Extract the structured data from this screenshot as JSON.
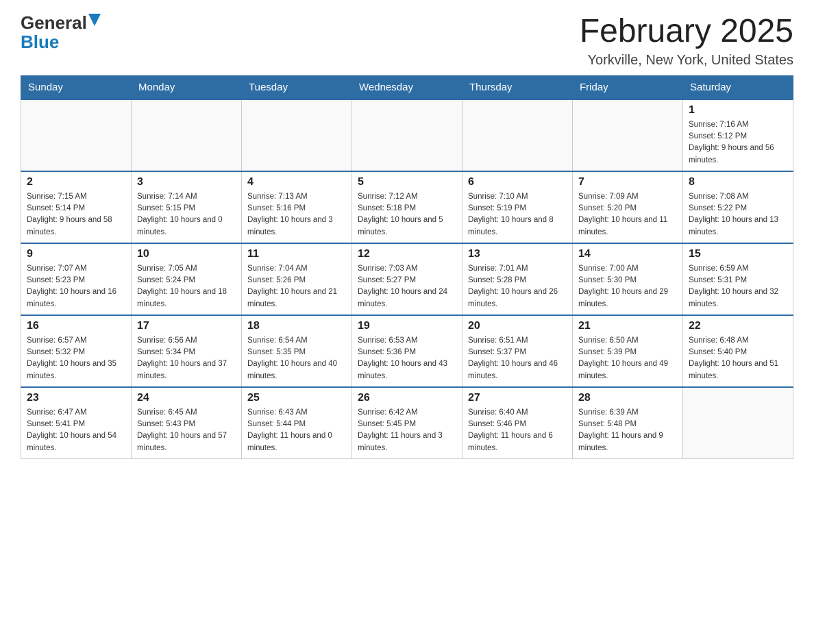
{
  "header": {
    "logo_general": "General",
    "logo_blue": "Blue",
    "month_year": "February 2025",
    "location": "Yorkville, New York, United States"
  },
  "weekdays": [
    "Sunday",
    "Monday",
    "Tuesday",
    "Wednesday",
    "Thursday",
    "Friday",
    "Saturday"
  ],
  "weeks": [
    [
      {
        "day": "",
        "info": ""
      },
      {
        "day": "",
        "info": ""
      },
      {
        "day": "",
        "info": ""
      },
      {
        "day": "",
        "info": ""
      },
      {
        "day": "",
        "info": ""
      },
      {
        "day": "",
        "info": ""
      },
      {
        "day": "1",
        "info": "Sunrise: 7:16 AM\nSunset: 5:12 PM\nDaylight: 9 hours and 56 minutes."
      }
    ],
    [
      {
        "day": "2",
        "info": "Sunrise: 7:15 AM\nSunset: 5:14 PM\nDaylight: 9 hours and 58 minutes."
      },
      {
        "day": "3",
        "info": "Sunrise: 7:14 AM\nSunset: 5:15 PM\nDaylight: 10 hours and 0 minutes."
      },
      {
        "day": "4",
        "info": "Sunrise: 7:13 AM\nSunset: 5:16 PM\nDaylight: 10 hours and 3 minutes."
      },
      {
        "day": "5",
        "info": "Sunrise: 7:12 AM\nSunset: 5:18 PM\nDaylight: 10 hours and 5 minutes."
      },
      {
        "day": "6",
        "info": "Sunrise: 7:10 AM\nSunset: 5:19 PM\nDaylight: 10 hours and 8 minutes."
      },
      {
        "day": "7",
        "info": "Sunrise: 7:09 AM\nSunset: 5:20 PM\nDaylight: 10 hours and 11 minutes."
      },
      {
        "day": "8",
        "info": "Sunrise: 7:08 AM\nSunset: 5:22 PM\nDaylight: 10 hours and 13 minutes."
      }
    ],
    [
      {
        "day": "9",
        "info": "Sunrise: 7:07 AM\nSunset: 5:23 PM\nDaylight: 10 hours and 16 minutes."
      },
      {
        "day": "10",
        "info": "Sunrise: 7:05 AM\nSunset: 5:24 PM\nDaylight: 10 hours and 18 minutes."
      },
      {
        "day": "11",
        "info": "Sunrise: 7:04 AM\nSunset: 5:26 PM\nDaylight: 10 hours and 21 minutes."
      },
      {
        "day": "12",
        "info": "Sunrise: 7:03 AM\nSunset: 5:27 PM\nDaylight: 10 hours and 24 minutes."
      },
      {
        "day": "13",
        "info": "Sunrise: 7:01 AM\nSunset: 5:28 PM\nDaylight: 10 hours and 26 minutes."
      },
      {
        "day": "14",
        "info": "Sunrise: 7:00 AM\nSunset: 5:30 PM\nDaylight: 10 hours and 29 minutes."
      },
      {
        "day": "15",
        "info": "Sunrise: 6:59 AM\nSunset: 5:31 PM\nDaylight: 10 hours and 32 minutes."
      }
    ],
    [
      {
        "day": "16",
        "info": "Sunrise: 6:57 AM\nSunset: 5:32 PM\nDaylight: 10 hours and 35 minutes."
      },
      {
        "day": "17",
        "info": "Sunrise: 6:56 AM\nSunset: 5:34 PM\nDaylight: 10 hours and 37 minutes."
      },
      {
        "day": "18",
        "info": "Sunrise: 6:54 AM\nSunset: 5:35 PM\nDaylight: 10 hours and 40 minutes."
      },
      {
        "day": "19",
        "info": "Sunrise: 6:53 AM\nSunset: 5:36 PM\nDaylight: 10 hours and 43 minutes."
      },
      {
        "day": "20",
        "info": "Sunrise: 6:51 AM\nSunset: 5:37 PM\nDaylight: 10 hours and 46 minutes."
      },
      {
        "day": "21",
        "info": "Sunrise: 6:50 AM\nSunset: 5:39 PM\nDaylight: 10 hours and 49 minutes."
      },
      {
        "day": "22",
        "info": "Sunrise: 6:48 AM\nSunset: 5:40 PM\nDaylight: 10 hours and 51 minutes."
      }
    ],
    [
      {
        "day": "23",
        "info": "Sunrise: 6:47 AM\nSunset: 5:41 PM\nDaylight: 10 hours and 54 minutes."
      },
      {
        "day": "24",
        "info": "Sunrise: 6:45 AM\nSunset: 5:43 PM\nDaylight: 10 hours and 57 minutes."
      },
      {
        "day": "25",
        "info": "Sunrise: 6:43 AM\nSunset: 5:44 PM\nDaylight: 11 hours and 0 minutes."
      },
      {
        "day": "26",
        "info": "Sunrise: 6:42 AM\nSunset: 5:45 PM\nDaylight: 11 hours and 3 minutes."
      },
      {
        "day": "27",
        "info": "Sunrise: 6:40 AM\nSunset: 5:46 PM\nDaylight: 11 hours and 6 minutes."
      },
      {
        "day": "28",
        "info": "Sunrise: 6:39 AM\nSunset: 5:48 PM\nDaylight: 11 hours and 9 minutes."
      },
      {
        "day": "",
        "info": ""
      }
    ]
  ]
}
